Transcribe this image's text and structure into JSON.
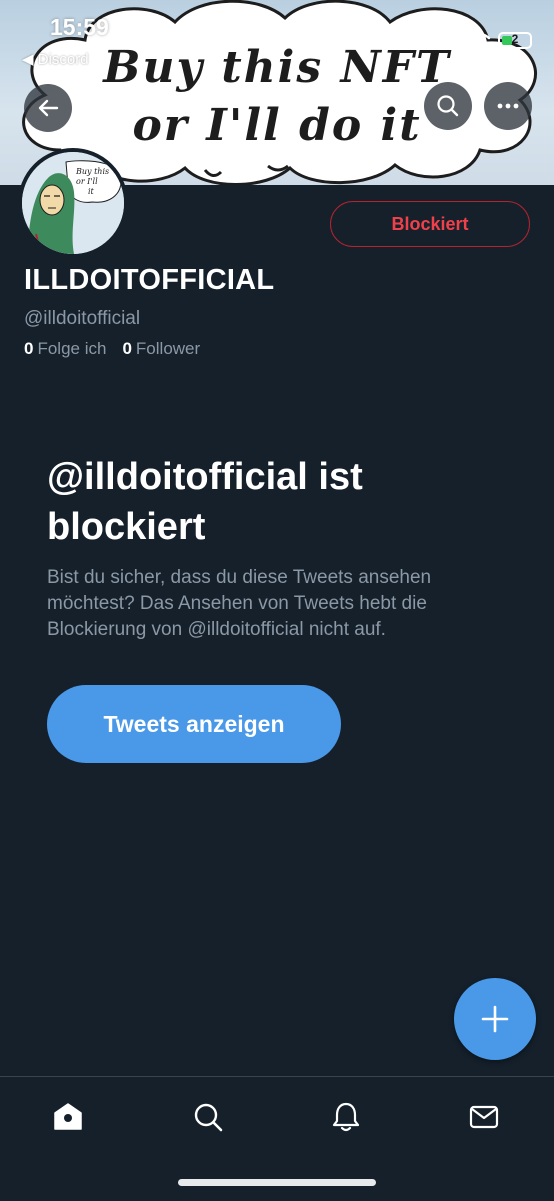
{
  "status_bar": {
    "time": "15:59",
    "back_app": "◀ Discord",
    "battery_level": "2"
  },
  "banner": {
    "line1": "Buy this NFT",
    "line2": "or I'll do it"
  },
  "avatar": {
    "line1": "Buy this",
    "line2": "or I'll",
    "line3": "it"
  },
  "profile": {
    "blocked_button": "Blockiert",
    "display_name": "ILLDOITOFFICIAL",
    "handle": "@illdoitofficial",
    "following_count": "0",
    "following_label": "Folge ich",
    "followers_count": "0",
    "followers_label": "Follower"
  },
  "notice": {
    "title": "@illdoitofficial ist blockiert",
    "body": "Bist du sicher, dass du diese Tweets ansehen möchtest? Das Ansehen von Tweets hebt die Blockierung von @illdoitofficial nicht auf.",
    "button": "Tweets anzeigen"
  },
  "icons": {
    "back": "arrow-left-icon",
    "search": "search-icon",
    "more": "more-icon",
    "compose": "plus-icon",
    "home": "home-icon",
    "tab_search": "search-icon",
    "notifications": "bell-icon",
    "messages": "mail-icon"
  },
  "colors": {
    "background": "#15202b",
    "accent": "#4a99e9",
    "blocked_red": "#f0414b",
    "secondary_text": "#8b98a5"
  }
}
